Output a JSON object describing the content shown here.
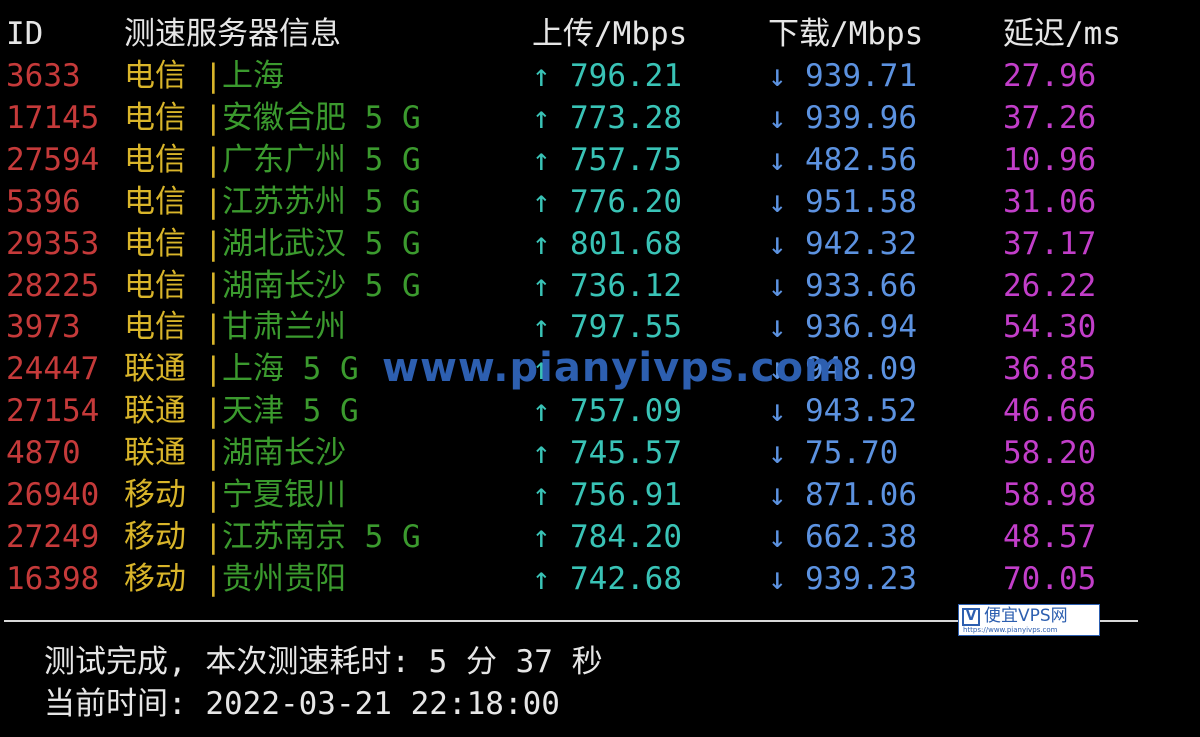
{
  "header": {
    "id": "ID",
    "server": "测速服务器信息",
    "upload": "上传/Mbps",
    "download": "下载/Mbps",
    "latency": "延迟/ms"
  },
  "arrows": {
    "up": "↑",
    "down": "↓",
    "separator": "|"
  },
  "rows": [
    {
      "id": "3633",
      "isp": "电信",
      "location": "上海",
      "upload": "796.21",
      "download": "939.71",
      "latency": "27.96"
    },
    {
      "id": "17145",
      "isp": "电信",
      "location": "安徽合肥 5 G",
      "upload": "773.28",
      "download": "939.96",
      "latency": "37.26"
    },
    {
      "id": "27594",
      "isp": "电信",
      "location": "广东广州 5 G",
      "upload": "757.75",
      "download": "482.56",
      "latency": "10.96"
    },
    {
      "id": "5396",
      "isp": "电信",
      "location": "江苏苏州 5 G",
      "upload": "776.20",
      "download": "951.58",
      "latency": "31.06"
    },
    {
      "id": "29353",
      "isp": "电信",
      "location": "湖北武汉 5 G",
      "upload": "801.68",
      "download": "942.32",
      "latency": "37.17"
    },
    {
      "id": "28225",
      "isp": "电信",
      "location": "湖南长沙 5 G",
      "upload": "736.12",
      "download": "933.66",
      "latency": "26.22"
    },
    {
      "id": "3973",
      "isp": "电信",
      "location": "甘肃兰州",
      "upload": "797.55",
      "download": "936.94",
      "latency": "54.30"
    },
    {
      "id": "24447",
      "isp": "联通",
      "location": "上海 5 G",
      "upload": "",
      "download": "948.09",
      "latency": "36.85"
    },
    {
      "id": "27154",
      "isp": "联通",
      "location": "天津 5 G",
      "upload": "757.09",
      "download": "943.52",
      "latency": "46.66"
    },
    {
      "id": "4870",
      "isp": "联通",
      "location": "湖南长沙",
      "upload": "745.57",
      "download": "75.70",
      "latency": "58.20"
    },
    {
      "id": "26940",
      "isp": "移动",
      "location": "宁夏银川",
      "upload": "756.91",
      "download": "871.06",
      "latency": "58.98"
    },
    {
      "id": "27249",
      "isp": "移动",
      "location": "江苏南京 5 G",
      "upload": "784.20",
      "download": "662.38",
      "latency": "48.57"
    },
    {
      "id": "16398",
      "isp": "移动",
      "location": "贵州贵阳",
      "upload": "742.68",
      "download": "939.23",
      "latency": "70.05"
    }
  ],
  "footer": {
    "completed": "测试完成, 本次测速耗时: 5 分 37 秒",
    "current_time": "当前时间: 2022-03-21 22:18:00"
  },
  "watermark": {
    "text": "www.pianyivps.com",
    "badge_title": "便宜VPS网",
    "badge_url": "https://www.pianyivps.com",
    "badge_logo": "V"
  },
  "colors": {
    "background": "#000000",
    "id": "#c53a3a",
    "isp": "#d9b52a",
    "location": "#3b9a2e",
    "upload": "#39c3b6",
    "download": "#5c92e0",
    "latency": "#c23ec9"
  }
}
